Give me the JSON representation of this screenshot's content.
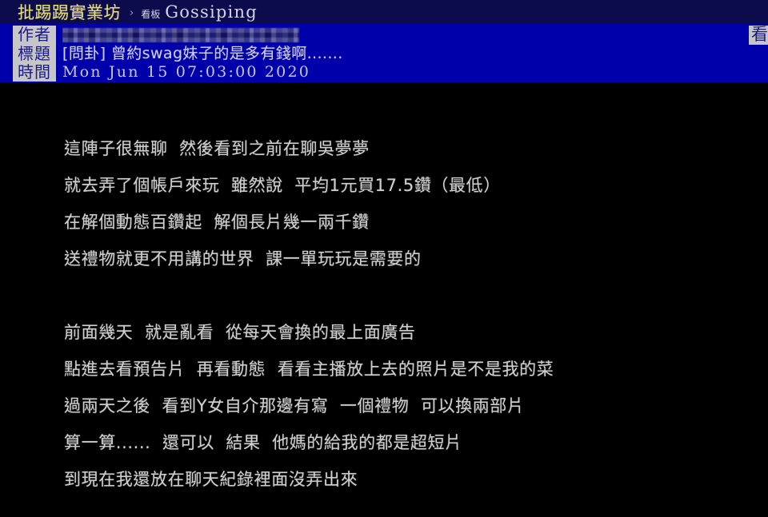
{
  "navbar": {
    "site_name": "批踢踢實業坊",
    "separator": "›",
    "board_label": "看板",
    "board_name": "Gossiping"
  },
  "meta": {
    "labels": {
      "author": "作者",
      "title": "標題",
      "time": "時間"
    },
    "author_value": "",
    "author_censored": true,
    "title_value": "[問卦] 曾約swag妹子的是多有錢啊.......",
    "time_value": "Mon  Jun  15  07:03:00  2020",
    "right_partial_label": "看"
  },
  "post_body": {
    "lines": [
      "這陣子很無聊  然後看到之前在聊吳夢夢",
      "就去弄了個帳戶來玩  雖然說  平均1元買17.5鑽（最低）",
      "在解個動態百鑽起  解個長片幾一兩千鑽",
      "送禮物就更不用講的世界  課一單玩玩是需要的",
      "",
      "前面幾天  就是亂看  從每天會換的最上面廣告",
      "點進去看預告片  再看動態  看看主播放上去的照片是不是我的菜",
      "過兩天之後  看到Y女自介那邊有寫  一個禮物  可以換兩部片",
      "算一算......  還可以  結果  他媽的給我的都是超短片",
      "到現在我還放在聊天紀錄裡面沒弄出來"
    ]
  },
  "colors": {
    "navbar_background": "#0c0c4d",
    "meta_background": "#0000aa",
    "body_background": "#000000",
    "site_name_color": "#e8e070",
    "label_box_color": "#c6c6c6",
    "label_text_color": "#1a1a8c",
    "body_text_color": "#cfcfcf"
  }
}
